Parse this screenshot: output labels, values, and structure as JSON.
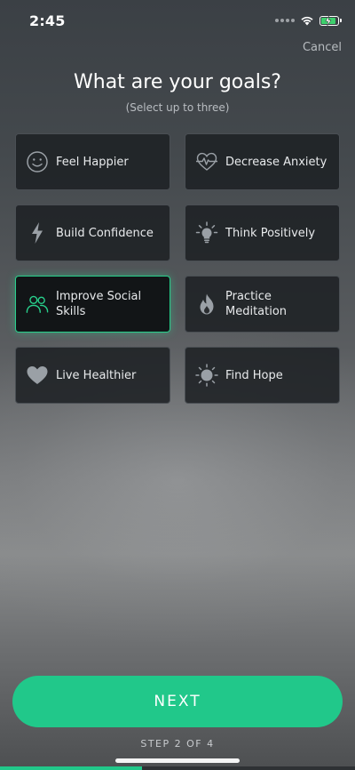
{
  "status_bar": {
    "time": "2:45",
    "battery_level": 0.9
  },
  "header": {
    "cancel_label": "Cancel",
    "title": "What are your goals?",
    "subtitle": "(Select up to three)"
  },
  "goals": [
    {
      "label": "Feel Happier",
      "icon": "smiley-icon",
      "selected": false
    },
    {
      "label": "Decrease Anxiety",
      "icon": "heartbeat-icon",
      "selected": false
    },
    {
      "label": "Build Confidence",
      "icon": "lightning-icon",
      "selected": false
    },
    {
      "label": "Think Positively",
      "icon": "lightbulb-icon",
      "selected": false
    },
    {
      "label": "Improve Social Skills",
      "icon": "people-icon",
      "selected": true
    },
    {
      "label": "Practice Meditation",
      "icon": "flame-icon",
      "selected": false
    },
    {
      "label": "Live Healthier",
      "icon": "heart-icon",
      "selected": false
    },
    {
      "label": "Find Hope",
      "icon": "sun-icon",
      "selected": false
    }
  ],
  "footer": {
    "next_label": "NEXT",
    "step_label": "STEP 2 OF 4",
    "progress": 0.4
  },
  "colors": {
    "accent": "#21c88a",
    "selected_border": "#28d08c",
    "card_bg": "#1e2124",
    "battery": "#3ed06d"
  }
}
